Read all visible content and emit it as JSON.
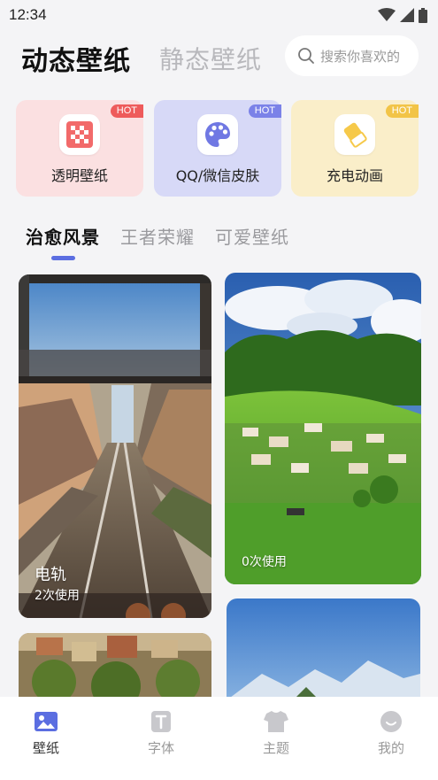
{
  "status_bar": {
    "time": "12:34"
  },
  "header": {
    "tab_active": "动态壁纸",
    "tab_inactive": "静态壁纸",
    "search_placeholder": "搜索你喜欢的"
  },
  "features": [
    {
      "label": "透明壁纸",
      "badge": "HOT",
      "icon": "checkerboard-icon"
    },
    {
      "label": "QQ/微信皮肤",
      "badge": "HOT",
      "icon": "palette-icon"
    },
    {
      "label": "充电动画",
      "badge": "HOT",
      "icon": "eraser-icon"
    }
  ],
  "categories": [
    "治愈风景",
    "王者荣耀",
    "可爱壁纸"
  ],
  "wallpapers": [
    {
      "title": "电轨",
      "usage": "2次使用"
    },
    {
      "title": "",
      "usage": "0次使用"
    }
  ],
  "bottom_nav": [
    "壁纸",
    "字体",
    "主题",
    "我的"
  ],
  "colors": {
    "accent": "#5b6ee1",
    "card_pink": "#fbe0e1",
    "card_purple": "#d7d9f7",
    "card_yellow": "#faeec9",
    "hot_red": "#ee5b5b",
    "hot_blue": "#7b82e8",
    "hot_yellow": "#f2c447"
  }
}
